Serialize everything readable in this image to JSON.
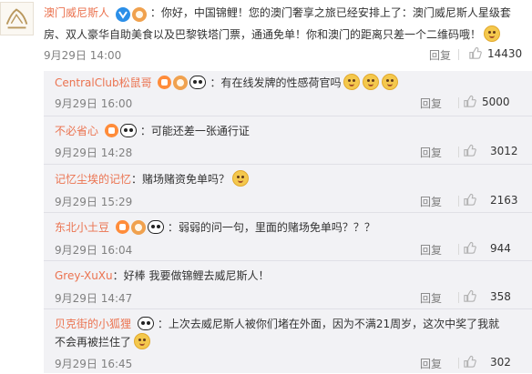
{
  "main": {
    "author": "澳门威尼斯人",
    "text": "：你好，中国锦鲤！您的澳门奢享之旅已经安排上了：澳门威尼斯人星级套房、双人豪华自助美食以及巴黎铁塔门票，通通免单！你和澳门的距离只差一个二维码哦！",
    "time": "9月29日 14:00",
    "reply_label": "回复",
    "likes": "14430"
  },
  "replies": [
    {
      "author": "CentralClub松鼠哥",
      "text": "：有在线发牌的性感荷官吗",
      "time": "9月29日 16:00",
      "reply_label": "回复",
      "likes": "5000"
    },
    {
      "author": "不必省心",
      "text": "：可能还差一张通行证",
      "time": "9月29日 14:28",
      "reply_label": "回复",
      "likes": "3012"
    },
    {
      "author": "记忆尘埃的记忆",
      "text": "：赌场赌资免单吗？",
      "time": "9月29日 15:29",
      "reply_label": "回复",
      "likes": "2163"
    },
    {
      "author": "东北小土豆",
      "text": "：弱弱的问一句，里面的赌场免单吗？？？",
      "time": "9月29日 16:04",
      "reply_label": "回复",
      "likes": "944"
    },
    {
      "author": "Grey-XuXu",
      "text": "：好棒 我要做锦鲤去威尼斯人！",
      "time": "9月29日 14:47",
      "reply_label": "回复",
      "likes": "358"
    },
    {
      "author": "贝克街的小狐狸",
      "text": "：上次去威尼斯人被你们堵在外面，因为不满21周岁，这次中奖了我就不会再被拦住了",
      "time": "9月29日 16:45",
      "reply_label": "回复",
      "likes": "302"
    }
  ],
  "icons": {
    "verified": "verified-v-icon",
    "vip": "vip-badge-icon",
    "coin": "coin-badge-icon",
    "panda": "panda-badge-icon",
    "emoji": "doge-emoji-icon",
    "like": "thumbs-up-icon"
  },
  "colors": {
    "author_link": "#eb7350",
    "muted": "#808080",
    "reply_bg": "#f2f2f5",
    "verified_blue": "#2b8fe8"
  }
}
